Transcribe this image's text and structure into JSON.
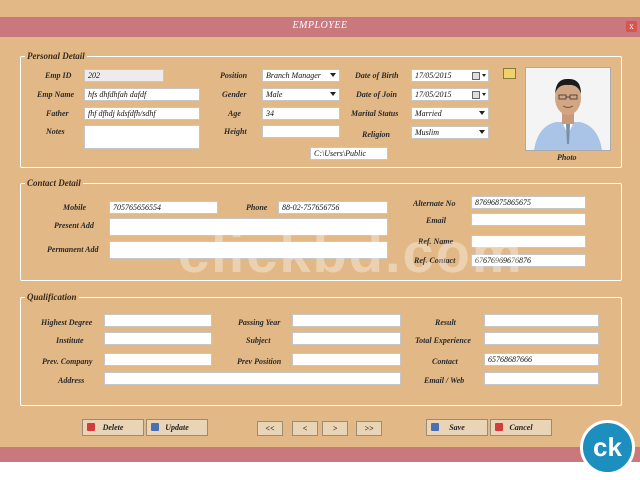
{
  "window": {
    "title": "EMPLOYEE",
    "close_label": "x"
  },
  "personal": {
    "legend": "Personal Detail",
    "emp_id_label": "Emp ID",
    "emp_id": "202",
    "emp_name_label": "Emp Name",
    "emp_name": "hfs dhfdhfah dafdf",
    "father_label": "Father",
    "father": "fhf dfhdj kdsfdfh/sdhf",
    "notes_label": "Notes",
    "notes": "",
    "position_label": "Position",
    "position": "Branch Manager",
    "gender_label": "Gender",
    "gender": "Male",
    "age_label": "Age",
    "age": "34",
    "height_label": "Height",
    "height": "",
    "dob_label": "Date of Birth",
    "dob": "17/05/2015",
    "doj_label": "Date of Join",
    "doj": "17/05/2015",
    "marital_label": "Marital Status",
    "marital": "Married",
    "religion_label": "Religion",
    "religion": "Muslim",
    "path": "C:\\Users\\Public",
    "photo_label": "Photo"
  },
  "contact": {
    "legend": "Contact Detail",
    "mobile_label": "Mobile",
    "mobile": "705765656554",
    "phone_label": "Phone",
    "phone": "88-02-757656756",
    "present_label": "Present Add",
    "present": "",
    "permanent_label": "Permanent Add",
    "permanent": "",
    "alt_label": "Alternate No",
    "alt": "87696875865675",
    "email_label": "Email",
    "email": "",
    "ref_name_label": "Ref. Name",
    "ref_name": "",
    "ref_contact_label": "Ref. Contact",
    "ref_contact": "67676969676876"
  },
  "qualification": {
    "legend": "Qualification",
    "degree_label": "Highest Degree",
    "degree": "",
    "institute_label": "Institute",
    "institute": "",
    "prev_company_label": "Prev. Company",
    "prev_company": "",
    "address_label": "Address",
    "address": "",
    "passing_year_label": "Passing Year",
    "passing_year": "",
    "subject_label": "Subject",
    "subject": "",
    "prev_position_label": "Prev Position",
    "prev_position": "",
    "result_label": "Result",
    "result": "",
    "experience_label": "Total Experience",
    "experience": "",
    "contact_label": "Contact",
    "contact": "65768687666",
    "web_label": "Email / Web",
    "web": ""
  },
  "buttons": {
    "delete": "Delete",
    "update": "Update",
    "first": "<<",
    "prev": "<",
    "next": ">",
    "last": ">>",
    "save": "Save",
    "cancel": "Cancel"
  },
  "watermark": "clickbd.com",
  "badge": "ck"
}
